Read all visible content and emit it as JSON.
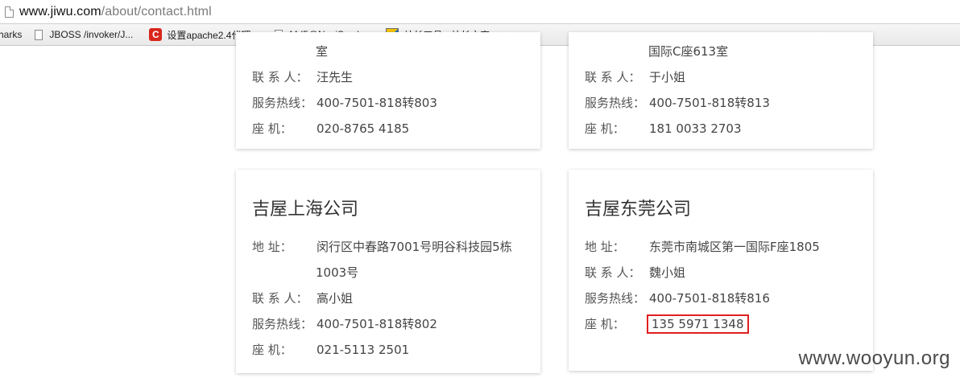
{
  "browser": {
    "url_host": "www.jiwu.com",
    "url_path": "/about/contact.html",
    "bookmarks": [
      {
        "label": "harks"
      },
      {
        "label": "JBOSS /invoker/J..."
      },
      {
        "label": "设置apache2.4代理..."
      },
      {
        "label": "Md5@NaviSec | ..."
      },
      {
        "label": "站长工具 - 站长之家"
      }
    ]
  },
  "cards": {
    "top_left": {
      "addr_cont": "室",
      "contact_label": "联 系 人：",
      "contact": "汪先生",
      "hotline_label": "服务热线：",
      "hotline": "400-7501-818转803",
      "phone_label": "座      机：",
      "phone": "020-8765 4185"
    },
    "top_right": {
      "addr_cont": "国际C座613室",
      "contact_label": "联 系 人：",
      "contact": "于小姐",
      "hotline_label": "服务热线：",
      "hotline": "400-7501-818转813",
      "phone_label": "座      机：",
      "phone": "181 0033 2703"
    },
    "shanghai": {
      "title": "吉屋上海公司",
      "addr_label": "地      址：",
      "addr": "闵行区中春路7001号明谷科技园5栋",
      "addr_cont": "1003号",
      "contact_label": "联 系 人：",
      "contact": "高小姐",
      "hotline_label": "服务热线：",
      "hotline": "400-7501-818转802",
      "phone_label": "座      机：",
      "phone": "021-5113 2501"
    },
    "dongguan": {
      "title": "吉屋东莞公司",
      "addr_label": "地      址：",
      "addr": "东莞市南城区第一国际F座1805",
      "contact_label": "联 系 人：",
      "contact": "魏小姐",
      "hotline_label": "服务热线：",
      "hotline": "400-7501-818转816",
      "phone_label": "座      机：",
      "phone": "135 5971 1348"
    }
  },
  "watermark": "www.wooyun.org",
  "colors": {
    "highlight_box": "#e02020",
    "card_shadow": "#cccccc"
  }
}
